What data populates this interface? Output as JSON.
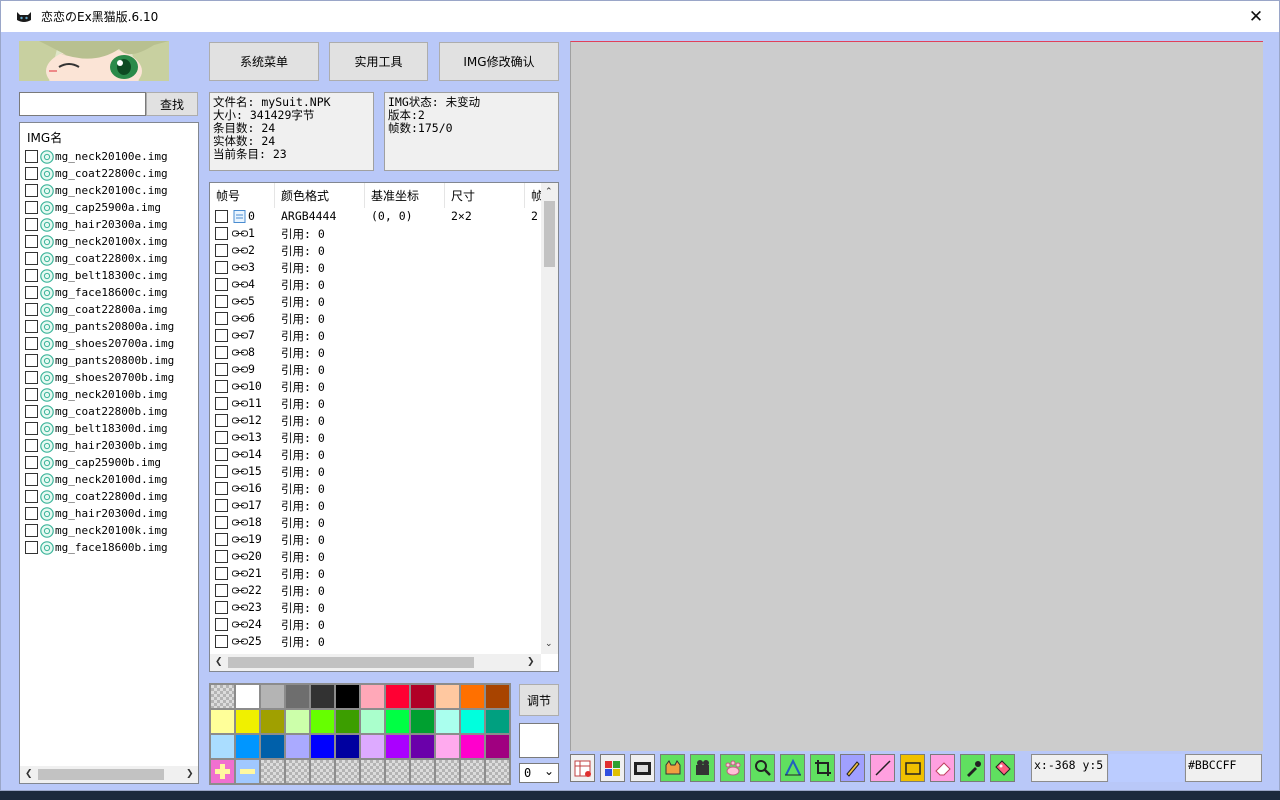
{
  "window": {
    "title": "恋恋のEx黑猫版.6.10",
    "close": "✕"
  },
  "search": {
    "value": "",
    "button": "查找"
  },
  "menu": {
    "system": "系统菜单",
    "tools": "实用工具",
    "img_confirm": "IMG修改确认"
  },
  "file_info": [
    "文件名: mySuit.NPK",
    "大小: 341429字节",
    "条目数: 24",
    "实体数: 24",
    "当前条目: 23"
  ],
  "img_info": [
    "IMG状态: 未变动",
    "版本:2",
    "帧数:175/0"
  ],
  "img_list": {
    "header": "IMG名",
    "items": [
      "mg_neck20100e.img",
      "mg_coat22800c.img",
      "mg_neck20100c.img",
      "mg_cap25900a.img",
      "mg_hair20300a.img",
      "mg_neck20100x.img",
      "mg_coat22800x.img",
      "mg_belt18300c.img",
      "mg_face18600c.img",
      "mg_coat22800a.img",
      "mg_pants20800a.img",
      "mg_shoes20700a.img",
      "mg_pants20800b.img",
      "mg_shoes20700b.img",
      "mg_neck20100b.img",
      "mg_coat22800b.img",
      "mg_belt18300d.img",
      "mg_hair20300b.img",
      "mg_cap25900b.img",
      "mg_neck20100d.img",
      "mg_coat22800d.img",
      "mg_hair20300d.img",
      "mg_neck20100k.img",
      "mg_face18600b.img"
    ]
  },
  "frames": {
    "columns": [
      "帧号",
      "颜色格式",
      "基准坐标",
      "尺寸",
      "帧"
    ],
    "first": {
      "index": "0",
      "format": "ARGB4444",
      "coord": "(0, 0)",
      "size": "2×2",
      "last": "2"
    },
    "ref_label": "引用: 0",
    "indices": [
      "1",
      "2",
      "3",
      "4",
      "5",
      "6",
      "7",
      "8",
      "9",
      "10",
      "11",
      "12",
      "13",
      "14",
      "15",
      "16",
      "17",
      "18",
      "19",
      "20",
      "21",
      "22",
      "23",
      "24",
      "25"
    ]
  },
  "palette": {
    "row1": [
      "checker",
      "#ffffff",
      "#b4b4b4",
      "#6e6e6e",
      "#323232",
      "#000000",
      "#ffa8b8",
      "#ff0033",
      "#b10026",
      "#ffc8a0",
      "#ff7000",
      "#a84400"
    ],
    "row2": [
      "#ffff99",
      "#f0f000",
      "#a0a000",
      "#ccffaa",
      "#66ff00",
      "#3c9e00",
      "#aaffcc",
      "#00ff44",
      "#00a030",
      "#aaffee",
      "#00ffdd",
      "#00a080"
    ],
    "row3": [
      "#aaddff",
      "#0096ff",
      "#0060aa",
      "#aaaaff",
      "#0000ff",
      "#0000a0",
      "#ddaaff",
      "#aa00ff",
      "#6a00aa",
      "#ffaaee",
      "#ff00cc",
      "#a00080"
    ],
    "row4": [
      "add",
      "remove",
      "checker",
      "checker",
      "checker",
      "checker",
      "checker",
      "checker",
      "checker",
      "checker",
      "checker",
      "checker"
    ],
    "adjust_button": "调节",
    "selected_color": "#ffffff",
    "layer_select": "0"
  },
  "canvas": {
    "background": "#cccccc",
    "border_color": "#e0405a"
  },
  "toolbar": {
    "tools": [
      "frame-table-icon",
      "palette-icon",
      "film-icon",
      "cat-icon",
      "projector-icon",
      "paw-icon",
      "zoom-icon",
      "align-icon",
      "crop-icon",
      "pencil-icon",
      "line-icon",
      "rectangle-icon",
      "eraser-icon",
      "eyedropper-icon",
      "tag-icon"
    ],
    "coords": "x:-368 y:5",
    "color_hex": "#BBCCFF",
    "color_preview": "#BBCCFF"
  }
}
